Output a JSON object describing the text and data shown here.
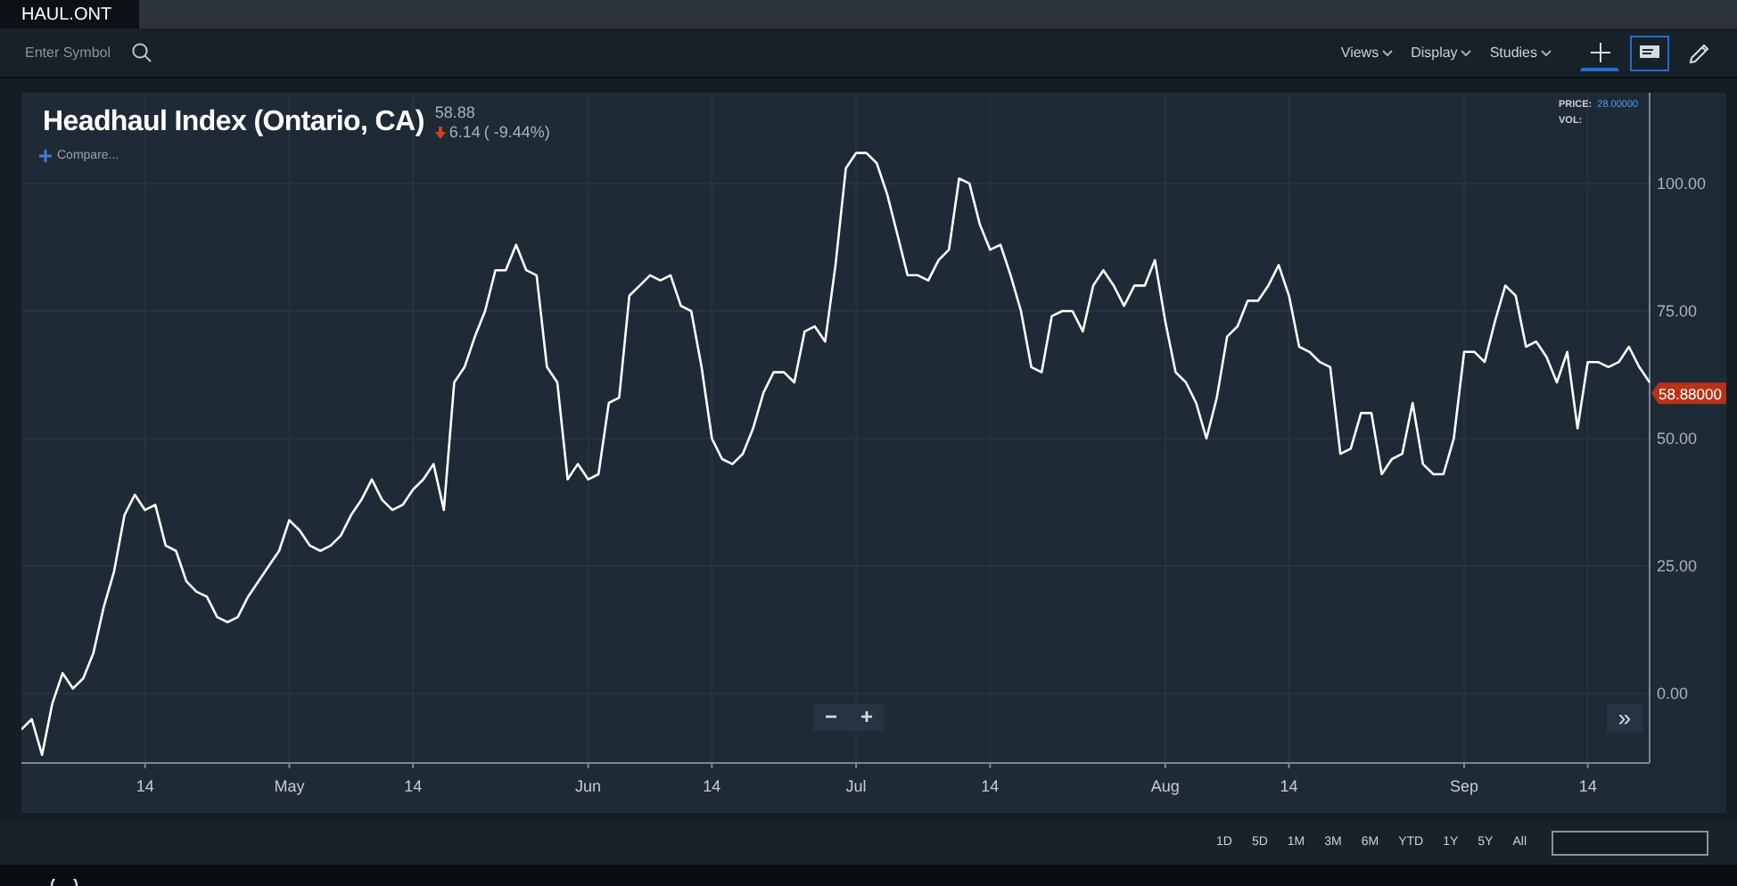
{
  "tabs": [
    {
      "label": "HAUL.ONT",
      "selected": true
    }
  ],
  "toolbar": {
    "symbol_field": {
      "placeholder": "Enter Symbol"
    },
    "menus": [
      {
        "label": "Views"
      },
      {
        "label": "Display"
      },
      {
        "label": "Studies"
      }
    ],
    "tools": [
      {
        "kind": "crosshair",
        "selected": true
      },
      {
        "kind": "comment",
        "selected": true
      },
      {
        "kind": "draw",
        "selected": false
      }
    ]
  },
  "chart": {
    "title": "Headhaul Index (Ontario, CA)",
    "last": "58.88",
    "change": "6.14",
    "change_pct": "( -9.44%)",
    "compare": "Compare...",
    "price_label": "PRICE:",
    "price_value": "28.00000",
    "vol_label": "VOL:",
    "current_tag": "58.88000",
    "zoom_out": "−",
    "zoom_in": "+",
    "scroll_end": "»",
    "chart_data": {
      "type": "line",
      "grid": true,
      "ylim": [
        -13.6,
        117.8
      ],
      "categories": [
        null,
        null,
        null,
        null,
        null,
        null,
        null,
        null,
        null,
        null,
        null,
        null,
        "14",
        null,
        null,
        null,
        null,
        null,
        null,
        null,
        null,
        null,
        null,
        null,
        null,
        null,
        "May",
        null,
        null,
        null,
        null,
        null,
        null,
        null,
        null,
        null,
        null,
        null,
        "14",
        null,
        null,
        null,
        null,
        null,
        null,
        null,
        null,
        null,
        null,
        null,
        null,
        null,
        null,
        null,
        null,
        "Jun",
        null,
        null,
        null,
        null,
        null,
        null,
        null,
        null,
        null,
        null,
        null,
        "14",
        null,
        null,
        null,
        null,
        null,
        null,
        null,
        null,
        null,
        null,
        null,
        null,
        null,
        "Jul",
        null,
        null,
        null,
        null,
        null,
        null,
        null,
        null,
        null,
        null,
        null,
        null,
        "14",
        null,
        null,
        null,
        null,
        null,
        null,
        null,
        null,
        null,
        null,
        null,
        null,
        null,
        null,
        null,
        null,
        "Aug",
        null,
        null,
        null,
        null,
        null,
        null,
        null,
        null,
        null,
        null,
        null,
        "14",
        null,
        null,
        null,
        null,
        null,
        null,
        null,
        null,
        null,
        null,
        null,
        null,
        null,
        null,
        null,
        null,
        "Sep",
        null,
        null,
        null,
        null,
        null,
        null,
        null,
        null,
        null,
        null,
        null,
        "14",
        null,
        null,
        null,
        null,
        null,
        null
      ],
      "yticks": [
        {
          "value": 0,
          "label": "0.00"
        },
        {
          "value": 25,
          "label": "25.00"
        },
        {
          "value": 50,
          "label": "50.00"
        },
        {
          "value": 75,
          "label": "75.00"
        },
        {
          "value": 100,
          "label": "100.00"
        }
      ],
      "series": [
        {
          "color": "#ffffff",
          "values": [
            -7,
            -5,
            -12,
            -2,
            4,
            1,
            3,
            8,
            17,
            24,
            35,
            39,
            36,
            37,
            29,
            28,
            22,
            20,
            19,
            15,
            14,
            15,
            19,
            22,
            25,
            28,
            34,
            32,
            29,
            28,
            29,
            31,
            35,
            38,
            42,
            38,
            36,
            37,
            40,
            42,
            45,
            36,
            61,
            64,
            70,
            75,
            83,
            83,
            88,
            83,
            82,
            64,
            61,
            42,
            45,
            42,
            43,
            57,
            58,
            78,
            80,
            82,
            81,
            82,
            76,
            75,
            64,
            50,
            46,
            45,
            47,
            52,
            59,
            63,
            63,
            61,
            71,
            72,
            69,
            84,
            103,
            106,
            106,
            104,
            98,
            90,
            82,
            82,
            81,
            85,
            87,
            101,
            100,
            92,
            87,
            88,
            82,
            75,
            64,
            63,
            74,
            75,
            75,
            71,
            80,
            83,
            80,
            76,
            80,
            80,
            85,
            73,
            63,
            61,
            57,
            50,
            58,
            70,
            72,
            77,
            77,
            80,
            84,
            78,
            68,
            67,
            65,
            64,
            47,
            48,
            55,
            55,
            43,
            46,
            47,
            57,
            45,
            43,
            43,
            50,
            67,
            67,
            65,
            73,
            80,
            78,
            68,
            69,
            66,
            61,
            67,
            52,
            65,
            65,
            64,
            65,
            68,
            64,
            61
          ]
        }
      ]
    }
  },
  "ranges": [
    {
      "label": "1D",
      "selected": false
    },
    {
      "label": "5D",
      "selected": false
    },
    {
      "label": "1M",
      "selected": false
    },
    {
      "label": "3M",
      "selected": false
    },
    {
      "label": "6M",
      "selected": false
    },
    {
      "label": "YTD",
      "selected": false
    },
    {
      "label": "1Y",
      "selected": false
    },
    {
      "label": "5Y",
      "selected": false
    },
    {
      "label": "All",
      "selected": false
    }
  ]
}
